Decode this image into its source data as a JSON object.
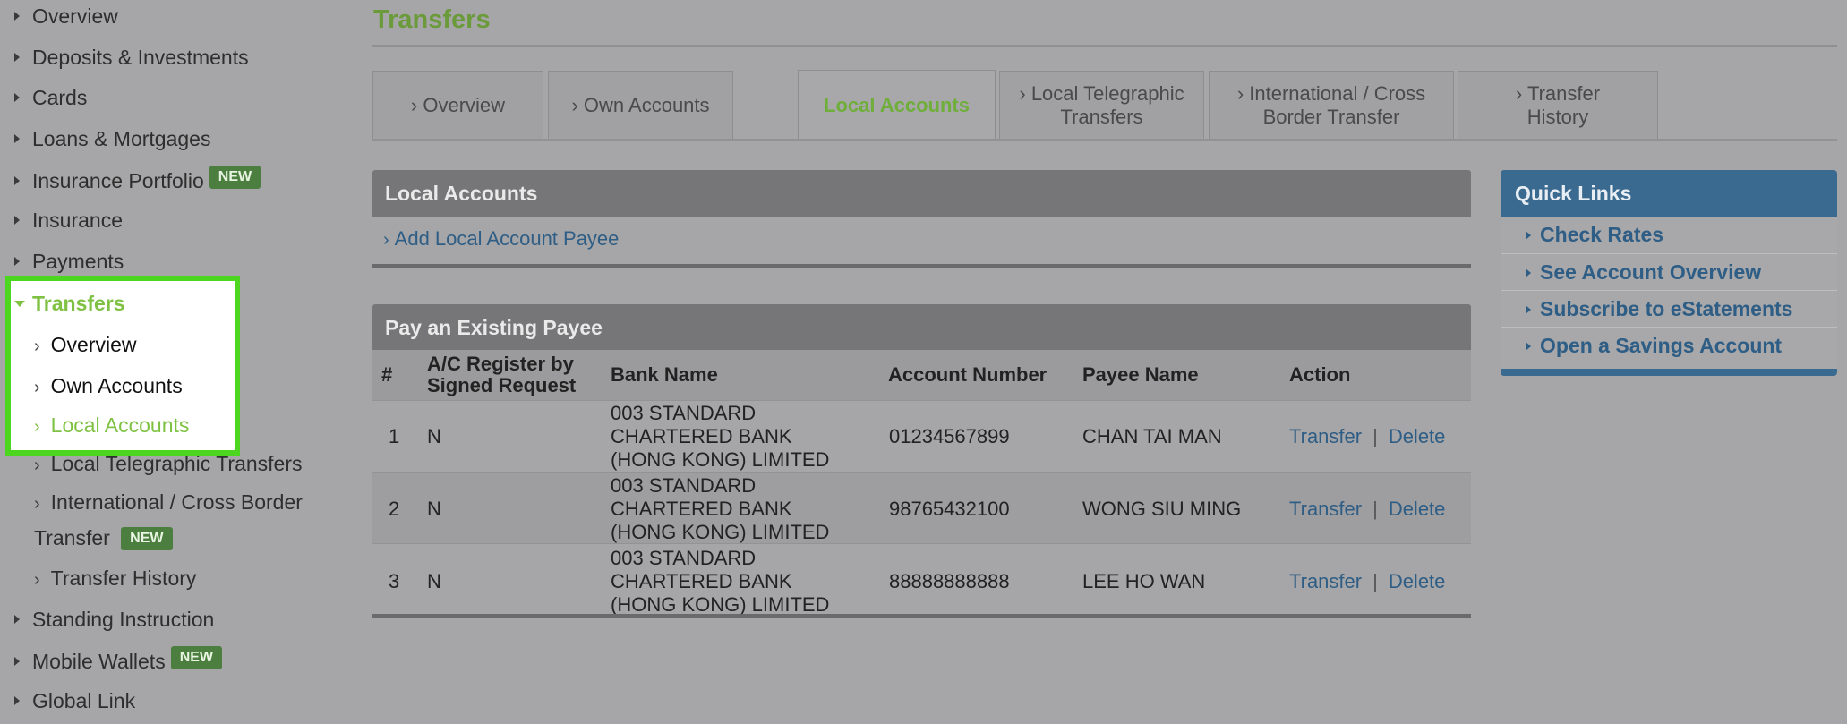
{
  "sidebar": {
    "items_top": [
      {
        "label": "Overview"
      },
      {
        "label": "Deposits & Investments"
      },
      {
        "label": "Cards"
      },
      {
        "label": "Loans & Mortgages"
      },
      {
        "label": "Insurance Portfolio",
        "badge": "NEW"
      },
      {
        "label": "Insurance"
      },
      {
        "label": "Payments"
      }
    ],
    "transfers": {
      "label": "Transfers",
      "children": [
        {
          "label": "Overview"
        },
        {
          "label": "Own Accounts"
        },
        {
          "label": "Local Accounts"
        },
        {
          "label": "Local Telegraphic Transfers"
        },
        {
          "label_line1": "International / Cross Border",
          "label_line2": "Transfer",
          "badge": "NEW"
        },
        {
          "label": "Transfer History"
        }
      ]
    },
    "items_bottom": [
      {
        "label": "Standing Instruction"
      },
      {
        "label": "Mobile Wallets",
        "badge": "NEW"
      },
      {
        "label": "Global Link"
      }
    ]
  },
  "main": {
    "title": "Transfers",
    "tabs": [
      {
        "line1": "Overview",
        "line2": ""
      },
      {
        "line1": "Own Accounts",
        "line2": ""
      },
      {
        "line1": "Local Accounts",
        "line2": ""
      },
      {
        "line1": "Local Telegraphic",
        "line2": "Transfers"
      },
      {
        "line1": "International / Cross",
        "line2": "Border Transfer"
      },
      {
        "line1": "Transfer",
        "line2": "History"
      }
    ],
    "local_accounts": {
      "header": "Local Accounts",
      "add_link": "Add Local Account Payee"
    },
    "payees": {
      "header": "Pay an Existing Payee",
      "columns": {
        "num": "#",
        "register_line1": "A/C Register by",
        "register_line2": "Signed Request",
        "bank": "Bank Name",
        "account": "Account Number",
        "payee": "Payee Name",
        "action": "Action"
      },
      "rows": [
        {
          "num": "1",
          "register": "N",
          "bank_line1": "003 STANDARD",
          "bank_line2": "CHARTERED BANK",
          "bank_line3": "(HONG KONG) LIMITED",
          "account": "01234567899",
          "payee": "CHAN TAI MAN",
          "transfer": "Transfer",
          "sep": "|",
          "delete": "Delete"
        },
        {
          "num": "2",
          "register": "N",
          "bank_line1": "003 STANDARD",
          "bank_line2": "CHARTERED BANK",
          "bank_line3": "(HONG KONG) LIMITED",
          "account": "98765432100",
          "payee": "WONG SIU MING",
          "transfer": "Transfer",
          "sep": "|",
          "delete": "Delete"
        },
        {
          "num": "3",
          "register": "N",
          "bank_line1": "003 STANDARD",
          "bank_line2": "CHARTERED BANK",
          "bank_line3": "(HONG KONG) LIMITED",
          "account": "88888888888",
          "payee": "LEE HO WAN",
          "transfer": "Transfer",
          "sep": "|",
          "delete": "Delete"
        }
      ]
    }
  },
  "quick_links": {
    "title": "Quick Links",
    "items": [
      {
        "label": "Check Rates"
      },
      {
        "label": "See Account Overview"
      },
      {
        "label": "Subscribe to eStatements"
      },
      {
        "label": "Open a Savings Account"
      }
    ]
  },
  "colors": {
    "background": "#a6a6a8",
    "accent_green": "#7fc243",
    "highlight_border": "#4dd61f",
    "link_blue": "#2e5d85",
    "quicklinks_blue": "#3a6a8f"
  }
}
